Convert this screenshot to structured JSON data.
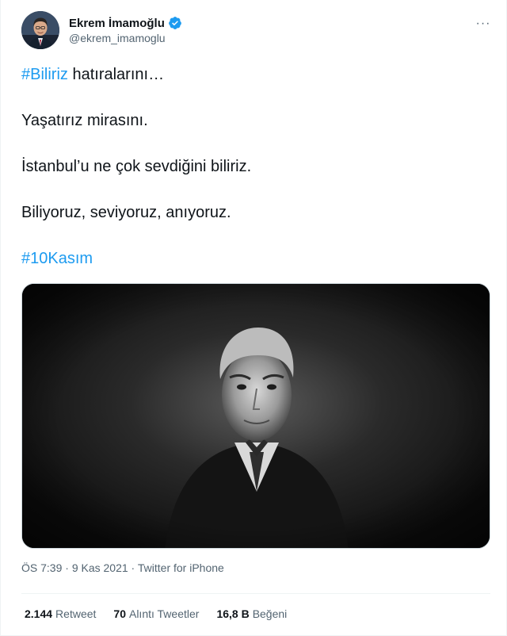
{
  "author": {
    "name": "Ekrem İmamoğlu",
    "handle": "@ekrem_imamoglu",
    "verified": true
  },
  "more_label": "···",
  "tweet": {
    "line1_hashtag": "#Biliriz",
    "line1_rest": " hatıralarını…",
    "line2": "Yaşatırız mirasını.",
    "line3": "İstanbul’u ne çok sevdiğini biliriz.",
    "line4": "Biliyoruz, seviyoruz, anıyoruz.",
    "line5_hashtag": "#10Kasım"
  },
  "meta": {
    "time": "ÖS 7:39",
    "sep1": " · ",
    "date": "9 Kas 2021",
    "sep2": " · ",
    "source": "Twitter for iPhone"
  },
  "stats": {
    "retweets_count": "2.144",
    "retweets_label": "Retweet",
    "quotes_count": "70",
    "quotes_label": "Alıntı Tweetler",
    "likes_count": "16,8 B",
    "likes_label": "Beğeni"
  },
  "colors": {
    "accent": "#1d9bf0",
    "text": "#0f1419",
    "secondary": "#536471"
  }
}
